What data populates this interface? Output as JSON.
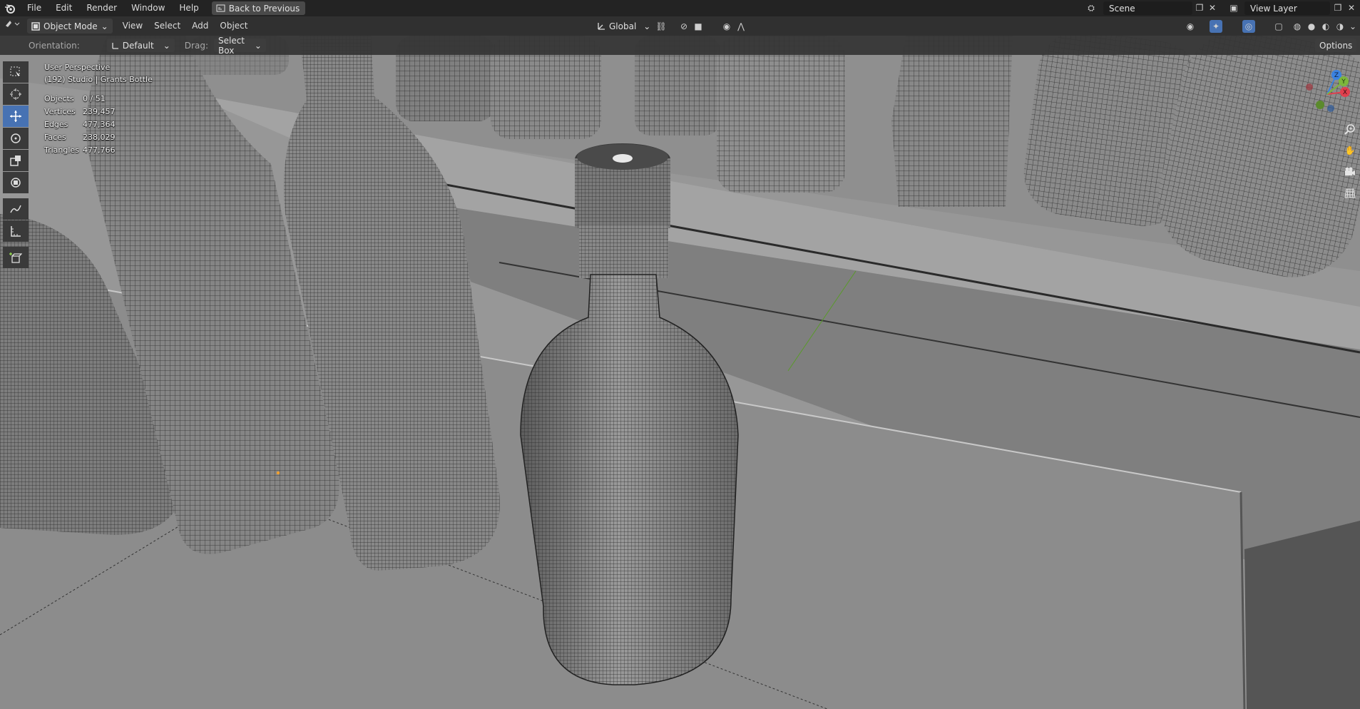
{
  "menu": {
    "items": [
      "File",
      "Edit",
      "Render",
      "Window",
      "Help"
    ],
    "back_button": "Back to Previous",
    "scene_label": "Scene",
    "view_layer_label": "View Layer"
  },
  "header": {
    "mode": "Object Mode",
    "menus": [
      "View",
      "Select",
      "Add",
      "Object"
    ],
    "transform_orientation": "Global"
  },
  "tool_settings": {
    "orientation_label": "Orientation:",
    "orientation_value": "Default",
    "drag_label": "Drag:",
    "drag_value": "Select Box",
    "options_label": "Options"
  },
  "viewport": {
    "view_name": "User Perspective",
    "collection_info": "(192) Studio | Grants Bottle",
    "stats": [
      {
        "label": "Objects",
        "value": "0 / 51"
      },
      {
        "label": "Vertices",
        "value": "239,457"
      },
      {
        "label": "Edges",
        "value": "477,364"
      },
      {
        "label": "Faces",
        "value": "238,029"
      },
      {
        "label": "Triangles",
        "value": "477,766"
      }
    ]
  },
  "gizmo": {
    "axes": [
      "X",
      "Y",
      "Z"
    ],
    "colors": {
      "x": "#e0404e",
      "y": "#7db63c",
      "z": "#3b82e0"
    }
  },
  "colors": {
    "accent": "#4772b3",
    "header_bg": "#303030",
    "topbar_bg": "#232323"
  }
}
